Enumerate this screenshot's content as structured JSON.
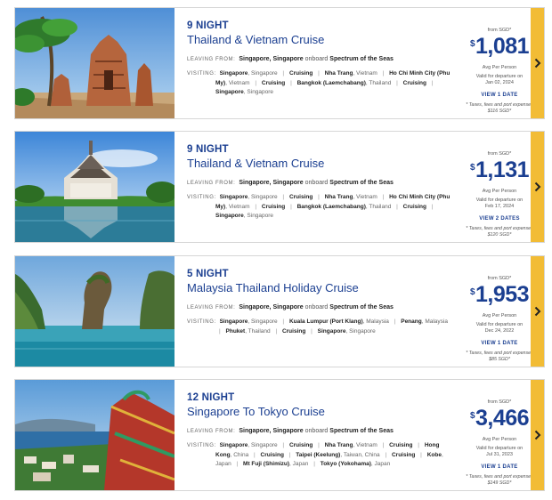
{
  "cruises": [
    {
      "nights": "9 NIGHT",
      "title": "Thailand & Vietnam Cruise",
      "leaving_label": "LEAVING FROM:",
      "port": "Singapore, Singapore",
      "onboard_word": "onboard",
      "ship": "Spectrum of the Seas",
      "visiting_label": "VISITING:",
      "stops": [
        {
          "name": "Singapore",
          "loc": ", Singapore"
        },
        {
          "name": "Cruising",
          "loc": ""
        },
        {
          "name": "Nha Trang",
          "loc": ", Vietnam"
        },
        {
          "name": "Ho Chi Minh City (Phu My)",
          "loc": ", Vietnam"
        },
        {
          "name": "Cruising",
          "loc": ""
        },
        {
          "name": "Bangkok (Laemchabang)",
          "loc": ", Thailand"
        },
        {
          "name": "Cruising",
          "loc": ""
        },
        {
          "name": "Singapore",
          "loc": ", Singapore"
        }
      ],
      "from": "from SGD*",
      "currency": "$",
      "price": "1,081",
      "per": "Avg Per Person",
      "valid": "Valid for departure on",
      "valid_date": "Jan 02, 2024",
      "dates_link": "VIEW 1 DATE",
      "fees": "* Taxes, fees and port expenses $116 SGD*"
    },
    {
      "nights": "9 NIGHT",
      "title": "Thailand & Vietnam Cruise",
      "leaving_label": "LEAVING FROM:",
      "port": "Singapore, Singapore",
      "onboard_word": "onboard",
      "ship": "Spectrum of the Seas",
      "visiting_label": "VISITING:",
      "stops": [
        {
          "name": "Singapore",
          "loc": ", Singapore"
        },
        {
          "name": "Cruising",
          "loc": ""
        },
        {
          "name": "Nha Trang",
          "loc": ", Vietnam"
        },
        {
          "name": "Ho Chi Minh City (Phu My)",
          "loc": ", Vietnam"
        },
        {
          "name": "Cruising",
          "loc": ""
        },
        {
          "name": "Bangkok (Laemchabang)",
          "loc": ", Thailand"
        },
        {
          "name": "Cruising",
          "loc": ""
        },
        {
          "name": "Singapore",
          "loc": ", Singapore"
        }
      ],
      "from": "from SGD*",
      "currency": "$",
      "price": "1,131",
      "per": "Avg Per Person",
      "valid": "Valid for departure on",
      "valid_date": "Feb 17, 2024",
      "dates_link": "VIEW 2 DATES",
      "fees": "* Taxes, fees and port expenses $120 SGD*"
    },
    {
      "nights": "5 NIGHT",
      "title": "Malaysia Thailand Holiday Cruise",
      "leaving_label": "LEAVING FROM:",
      "port": "Singapore, Singapore",
      "onboard_word": "onboard",
      "ship": "Spectrum of the Seas",
      "visiting_label": "VISITING:",
      "stops": [
        {
          "name": "Singapore",
          "loc": ", Singapore"
        },
        {
          "name": "Kuala Lumpur (Port Klang)",
          "loc": ", Malaysia"
        },
        {
          "name": "Penang",
          "loc": ", Malaysia"
        },
        {
          "name": "Phuket",
          "loc": ", Thailand"
        },
        {
          "name": "Cruising",
          "loc": ""
        },
        {
          "name": "Singapore",
          "loc": ", Singapore"
        }
      ],
      "from": "from SGD*",
      "currency": "$",
      "price": "1,953",
      "per": "Avg Per Person",
      "valid": "Valid for departure on",
      "valid_date": "Dec 24, 2022",
      "dates_link": "VIEW 1 DATE",
      "fees": "* Taxes, fees and port expenses $85 SGD*"
    },
    {
      "nights": "12 NIGHT",
      "title": "Singapore To Tokyo Cruise",
      "leaving_label": "LEAVING FROM:",
      "port": "Singapore, Singapore",
      "onboard_word": "onboard",
      "ship": "Spectrum of the Seas",
      "visiting_label": "VISITING:",
      "stops": [
        {
          "name": "Singapore",
          "loc": ", Singapore"
        },
        {
          "name": "Cruising",
          "loc": ""
        },
        {
          "name": "Nha Trang",
          "loc": ", Vietnam"
        },
        {
          "name": "Cruising",
          "loc": ""
        },
        {
          "name": "Hong Kong",
          "loc": ", China"
        },
        {
          "name": "Cruising",
          "loc": ""
        },
        {
          "name": "Taipei (Keelung)",
          "loc": ", Taiwan, China"
        },
        {
          "name": "Cruising",
          "loc": ""
        },
        {
          "name": "Kobe",
          "loc": ", Japan"
        },
        {
          "name": "Mt Fuji (Shimizu)",
          "loc": ", Japan"
        },
        {
          "name": "Tokyo (Yokohama)",
          "loc": ", Japan"
        }
      ],
      "from": "from SGD*",
      "currency": "$",
      "price": "3,466",
      "per": "Avg Per Person",
      "valid": "Valid for departure on",
      "valid_date": "Jul 31, 2023",
      "dates_link": "VIEW 1 DATE",
      "fees": "* Taxes, fees and port expenses $149 SGD*"
    }
  ],
  "colors": {
    "accent": "#1b3f91",
    "arrow_bar": "#f2bc35"
  },
  "icons": {
    "next": "chevron-right-icon"
  }
}
